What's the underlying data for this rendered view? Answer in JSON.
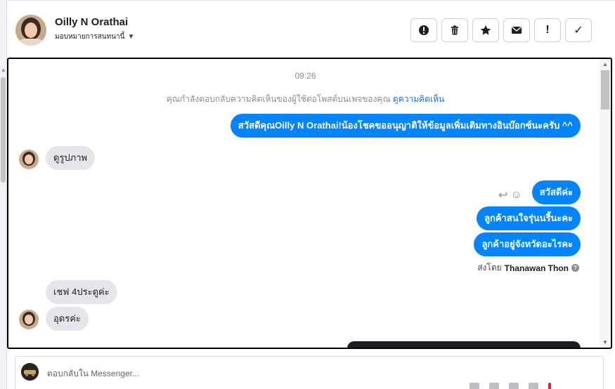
{
  "header": {
    "contact_name": "Oilly N Orathai",
    "assign_label": "มอบหมายการสนทนานี้",
    "actions": [
      {
        "icon": "alert-circle-icon",
        "label": ""
      },
      {
        "icon": "trash-icon",
        "label": ""
      },
      {
        "icon": "star-icon",
        "label": ""
      },
      {
        "icon": "envelope-icon",
        "label": ""
      },
      {
        "icon": "exclamation-icon",
        "label": "!"
      },
      {
        "icon": "check-icon",
        "label": "✓"
      }
    ]
  },
  "chat": {
    "timestamp": "09:26",
    "notice_text": "คุณกำลังตอบกลับความคิดเห็นของผู้ใช้ต่อโพสต์บนเพจของคุณ",
    "notice_link": "ดูความคิดเห็น",
    "messages": [
      {
        "side": "out",
        "text": "สวัสดีคุณOilly N Orathai!น้องโชคขออนุญาติให้ข้อมูลเพิ่มเติมทางอินบ๊อกซ์นะครับ ^^"
      },
      {
        "side": "in",
        "text": "ดูรูปภาพ"
      },
      {
        "side": "out",
        "text": "สวัสดีค่ะ"
      },
      {
        "side": "out",
        "text": "ลูกค้าสนใจรุ่นนรี้นะคะ"
      },
      {
        "side": "out",
        "text": "ลูกค้าอยู่จังหวัดอะไรคะ"
      },
      {
        "side": "in",
        "text": "เชฟ 4ประตูค่ะ"
      },
      {
        "side": "in",
        "text": "อุดรค่ะ"
      }
    ],
    "sent_by_prefix": "ส่งโดย",
    "sent_by_name": "Thanawan Thon"
  },
  "composer": {
    "placeholder": "ตอบกลับใน Messenger..."
  }
}
